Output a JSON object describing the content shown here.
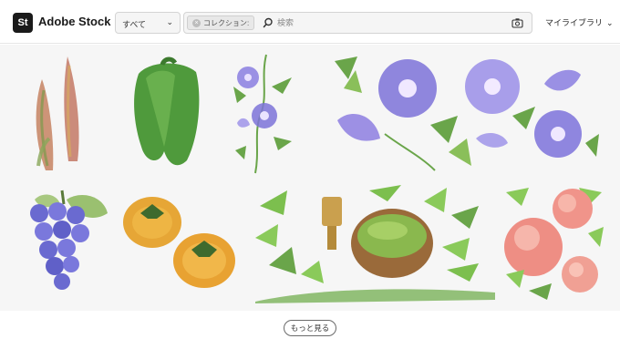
{
  "header": {
    "logo_mark": "St",
    "logo_text": "Adobe Stock",
    "filter_value": "すべて",
    "chip_label": "コレクション:",
    "search_placeholder": "検索",
    "library_label": "マイライブラリ"
  },
  "gallery": {
    "tiles": [
      {
        "name": "bamboo-shoots-tile",
        "icon": "bamboo-shoots"
      },
      {
        "name": "green-pepper-tile",
        "icon": "green-pepper"
      },
      {
        "name": "morning-glory-vine-tile",
        "icon": "morning-glory-vine"
      },
      {
        "name": "morning-glory-flowers-tile",
        "icon": "morning-glory-flowers"
      },
      {
        "name": "grapes-tile",
        "icon": "grapes"
      },
      {
        "name": "persimmons-tile",
        "icon": "persimmons"
      },
      {
        "name": "matcha-tea-tile",
        "icon": "matcha-tea"
      },
      {
        "name": "peaches-tile",
        "icon": "peaches"
      }
    ]
  },
  "footer": {
    "more_label": "もっと見る"
  },
  "colors": {
    "background": "#f6f6f6",
    "logo": "#1a1a1a",
    "morning_glory": "#8a7ee0",
    "leaf_green": "#6aa54a"
  }
}
